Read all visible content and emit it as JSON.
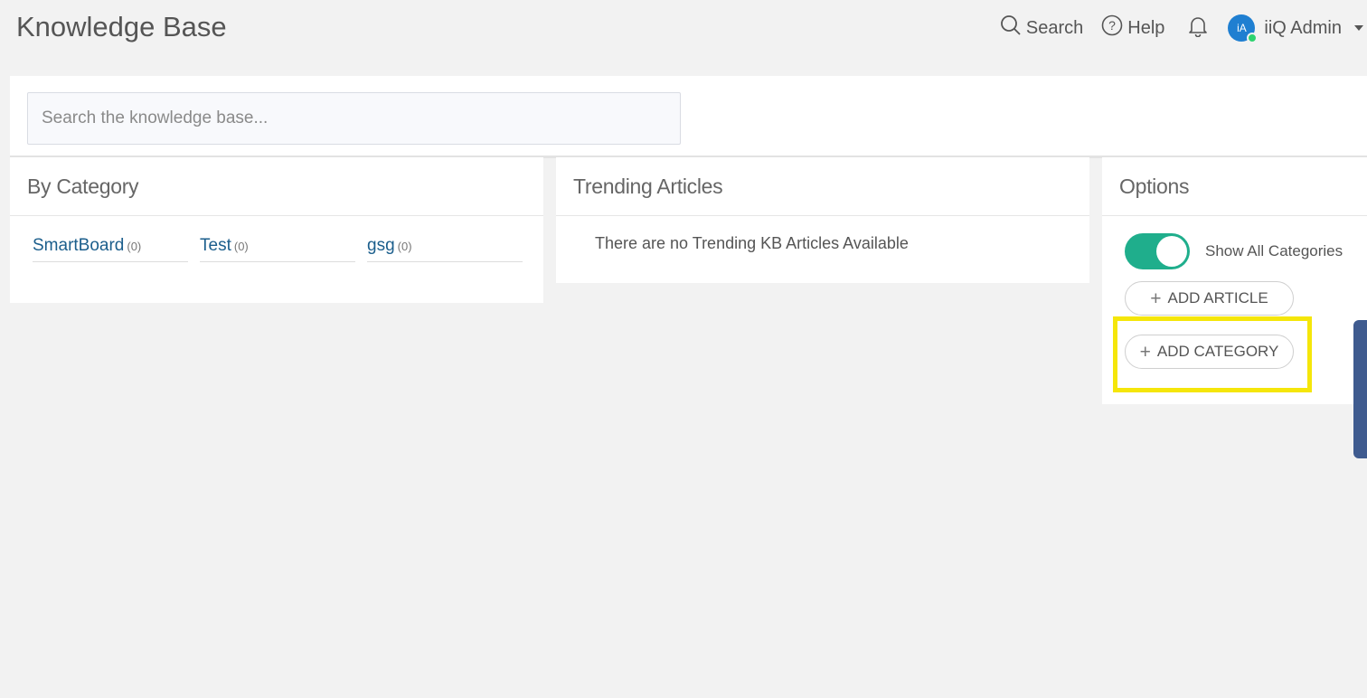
{
  "header": {
    "title": "Knowledge Base",
    "search_label": "Search",
    "help_label": "Help",
    "user": {
      "initials": "iA",
      "name": "iiQ Admin",
      "status_color": "#2dd36f"
    }
  },
  "search": {
    "placeholder": "Search the knowledge base..."
  },
  "categories": {
    "title": "By Category",
    "items": [
      {
        "name": "SmartBoard",
        "count": "(0)"
      },
      {
        "name": "Test",
        "count": "(0)"
      },
      {
        "name": "gsg",
        "count": "(0)"
      }
    ]
  },
  "trending": {
    "title": "Trending Articles",
    "empty_message": "There are no Trending KB Articles Available"
  },
  "options": {
    "title": "Options",
    "show_all_categories": {
      "label": "Show All Categories",
      "enabled": true
    },
    "add_article_label": "ADD ARTICLE",
    "add_category_label": "ADD CATEGORY"
  },
  "colors": {
    "accent_toggle": "#1fae8c",
    "link": "#1b5e8c",
    "highlight": "#f5e60a",
    "side_tab": "#3f5b8f"
  }
}
